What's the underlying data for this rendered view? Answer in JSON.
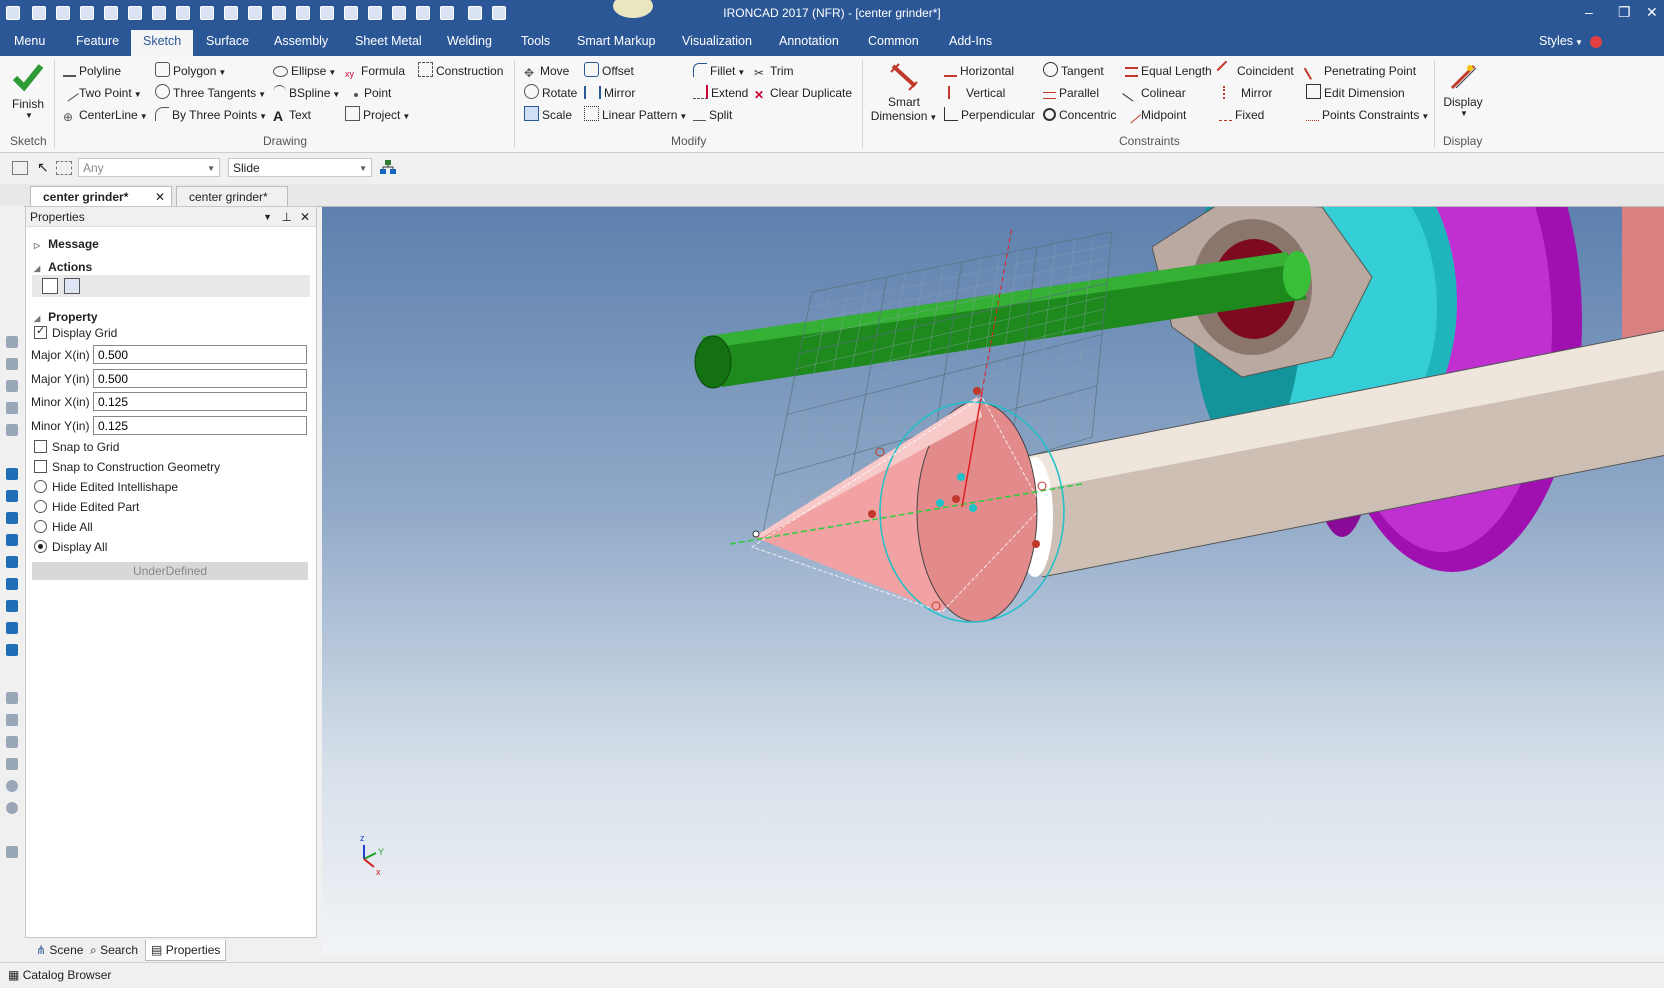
{
  "window": {
    "title": "IRONCAD 2017 (NFR) - [center grinder*]",
    "controls": [
      "–",
      "❐",
      "✕"
    ]
  },
  "ribbon_tabs": [
    "Menu",
    "Feature",
    "Sketch",
    "Surface",
    "Assembly",
    "Sheet Metal",
    "Welding",
    "Tools",
    "Smart Markup",
    "Visualization",
    "Annotation",
    "Common",
    "Add-Ins"
  ],
  "ribbon_right": {
    "styles": "Styles"
  },
  "ribbon": {
    "sketch_group": {
      "finish": "Finish",
      "name": "Sketch"
    },
    "drawing_group": {
      "name": "Drawing",
      "items": [
        "Polyline",
        "Polygon",
        "Ellipse",
        "Formula",
        "Construction",
        "Two Point",
        "Three Tangents",
        "BSpline",
        "Point",
        "CenterLine",
        "By Three Points",
        "Text",
        "Project"
      ]
    },
    "modify_group": {
      "name": "Modify",
      "items": [
        "Move",
        "Offset",
        "Fillet",
        "Trim",
        "Rotate",
        "Mirror",
        "Extend",
        "Clear Duplicate",
        "Scale",
        "Linear Pattern",
        "Split"
      ]
    },
    "constraints_group": {
      "name": "Constraints",
      "smart_dimension": [
        "Smart",
        "Dimension"
      ],
      "items": [
        "Horizontal",
        "Tangent",
        "Equal Length",
        "Coincident",
        "Penetrating Point",
        "Vertical",
        "Parallel",
        "Colinear",
        "Mirror",
        "Edit Dimension",
        "Perpendicular",
        "Concentric",
        "Midpoint",
        "Fixed",
        "Points Constraints"
      ]
    },
    "display_group": {
      "button": "Display",
      "name": "Display"
    }
  },
  "subbar": {
    "filter": "Any",
    "mode": "Slide"
  },
  "doc_tabs": [
    "center grinder*",
    "center grinder*"
  ],
  "properties": {
    "title": "Properties",
    "sections": {
      "message": "Message",
      "actions": "Actions",
      "property": "Property"
    },
    "display_grid": "Display Grid",
    "major_x_label": "Major X(in)",
    "major_x": "0.500",
    "major_y_label": "Major Y(in)",
    "major_y": "0.500",
    "minor_x_label": "Minor X(in)",
    "minor_x": "0.125",
    "minor_y_label": "Minor Y(in)",
    "minor_y": "0.125",
    "snap_grid": "Snap to Grid",
    "snap_construction": "Snap to Construction Geometry",
    "hide_edited_intellishape": "Hide Edited Intellishape",
    "hide_edited_part": "Hide Edited Part",
    "hide_all": "Hide All",
    "display_all": "Display All",
    "state": "UnderDefined"
  },
  "panel_tabs": [
    "Scene",
    "Search",
    "Properties"
  ],
  "catalog": "Catalog Browser",
  "triad": {
    "z": "z",
    "y": "Y",
    "x": "x"
  }
}
